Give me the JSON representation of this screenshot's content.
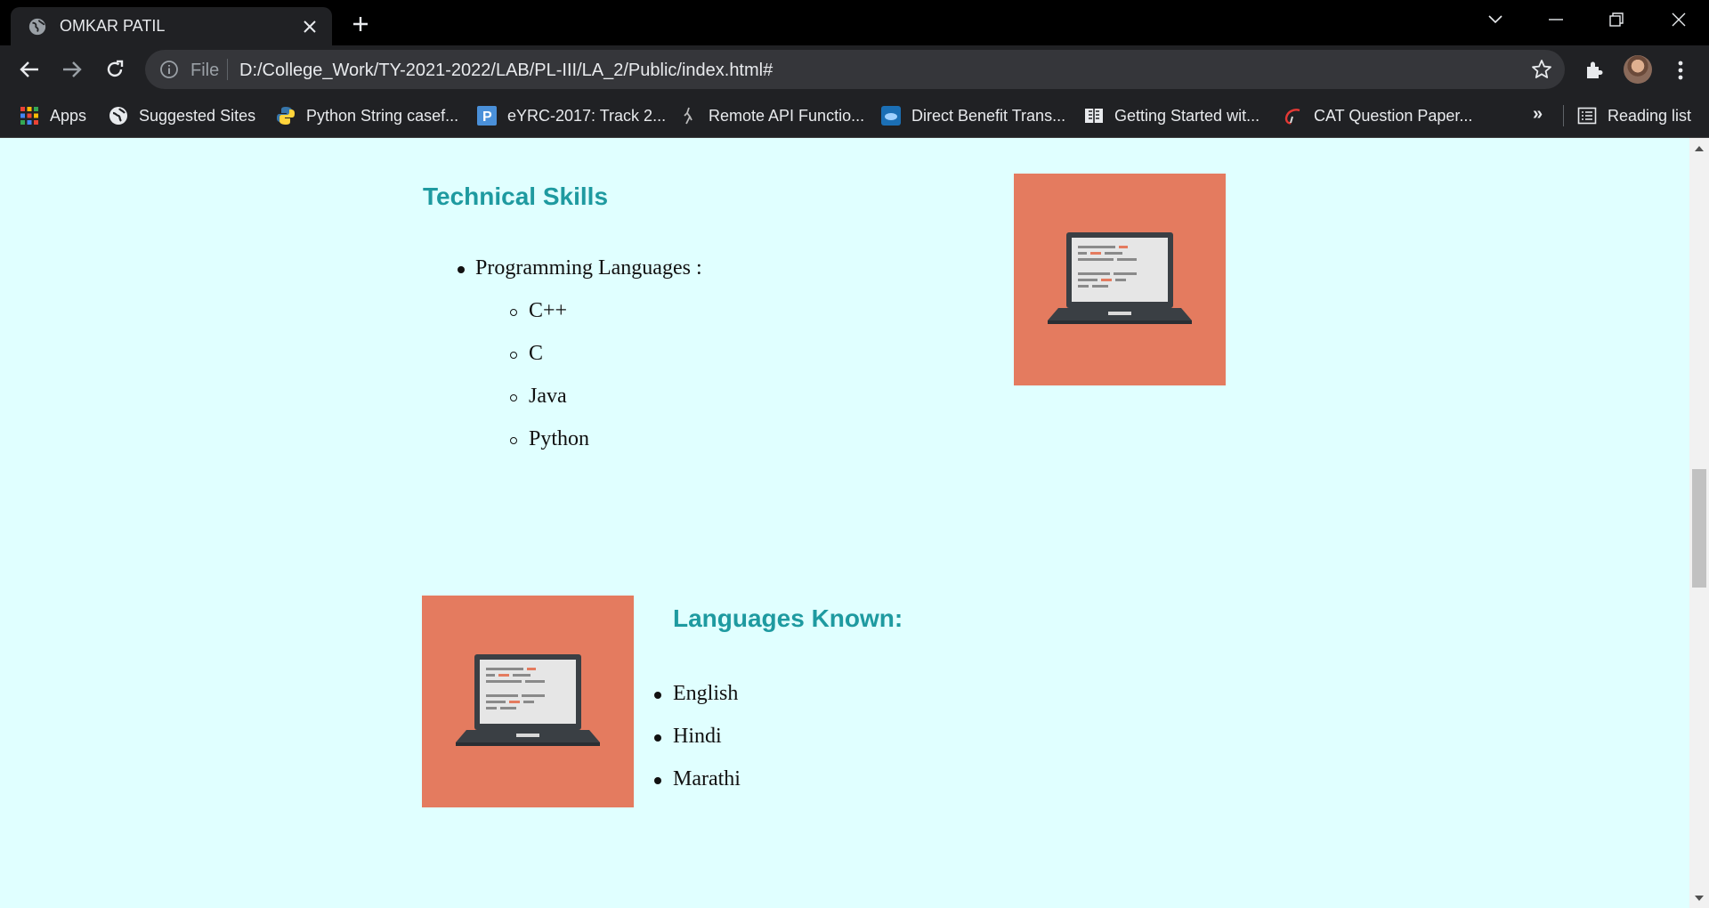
{
  "tab": {
    "title": "OMKAR PATIL"
  },
  "omnibox": {
    "scheme": "File",
    "url": "D:/College_Work/TY-2021-2022/LAB/PL-III/LA_2/Public/index.html#"
  },
  "bookmarks": [
    {
      "label": "Apps",
      "icon": "apps-grid-icon"
    },
    {
      "label": "Suggested Sites",
      "icon": "ie-icon"
    },
    {
      "label": "Python String casef...",
      "icon": "python-icon"
    },
    {
      "label": "eYRC-2017: Track 2...",
      "icon": "p-icon"
    },
    {
      "label": "Remote API Functio...",
      "icon": "figure-icon"
    },
    {
      "label": "Direct Benefit Trans...",
      "icon": "dbt-icon"
    },
    {
      "label": "Getting Started wit...",
      "icon": "book-icon"
    },
    {
      "label": "CAT Question Paper...",
      "icon": "cat-icon"
    }
  ],
  "bookmarks_more": "»",
  "reading_list": "Reading list",
  "page": {
    "technical_heading": "Technical Skills",
    "programming_label": "Programming Languages :",
    "programming_items": [
      "C++",
      "C",
      "Java",
      "Python"
    ],
    "languages_heading": "Languages Known:",
    "languages_items": [
      "English",
      "Hindi",
      "Marathi"
    ]
  },
  "colors": {
    "page_background": "#e0ffff",
    "heading": "#1e9aa0",
    "image_background": "#e47b5f",
    "browser_chrome": "#202124"
  }
}
